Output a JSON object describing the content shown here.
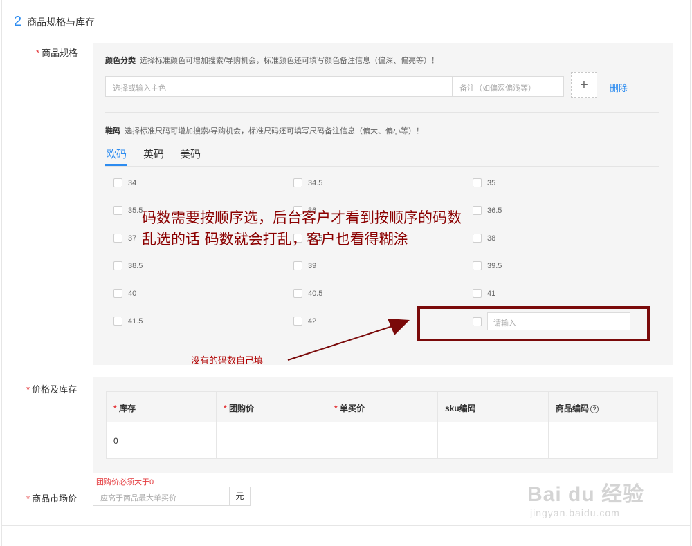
{
  "section": {
    "number": "2",
    "title": "商品规格与库存"
  },
  "spec": {
    "label": "商品规格",
    "color": {
      "title": "颜色分类",
      "hint": "选择标准颜色可增加搜索/导购机会，标准颜色还可填写颜色备注信息（偏深、偏亮等）！",
      "main_placeholder": "选择或输入主色",
      "remark_placeholder": "备注（如偏深偏浅等）",
      "add_label": "+",
      "delete_label": "删除"
    },
    "size": {
      "title": "鞋码",
      "hint": "选择标准尺码可增加搜索/导购机会，标准尺码还可填写尺码备注信息（偏大、偏小等）！",
      "tabs": [
        "欧码",
        "英码",
        "美码"
      ],
      "active_tab": 0,
      "options": [
        "34",
        "34.5",
        "35",
        "35.5",
        "36",
        "36.5",
        "37",
        "37.5",
        "38",
        "38.5",
        "39",
        "39.5",
        "40",
        "40.5",
        "41",
        "41.5",
        "42"
      ],
      "custom_placeholder": "请输入"
    }
  },
  "annotations": {
    "line1": "码数需要按顺序选，后台客户才看到按顺序的码数",
    "line2": "乱选的话 码数就会打乱，客户也看得糊涂",
    "arrow_caption": "没有的码数自己填",
    "color": "#8b0000"
  },
  "price": {
    "label": "价格及库存",
    "columns": [
      {
        "label": "库存",
        "required": "*"
      },
      {
        "label": "团购价",
        "required": "*"
      },
      {
        "label": "单买价",
        "required": "*"
      },
      {
        "label": "sku编码",
        "required": ""
      },
      {
        "label": "商品编码",
        "required": "",
        "help": "?"
      }
    ],
    "rows": [
      [
        "0",
        "",
        "",
        "",
        ""
      ]
    ]
  },
  "market": {
    "error": "团购价必须大于0",
    "label": "商品市场价",
    "placeholder": "应高于商品最大单买价",
    "unit": "元"
  },
  "required_mark": "*",
  "watermark": {
    "main": "Bai du 经验",
    "sub": "jingyan.baidu.com"
  },
  "colors": {
    "accent": "#2d8cf0",
    "required": "#e4393c",
    "panel": "#f5f5f5"
  }
}
